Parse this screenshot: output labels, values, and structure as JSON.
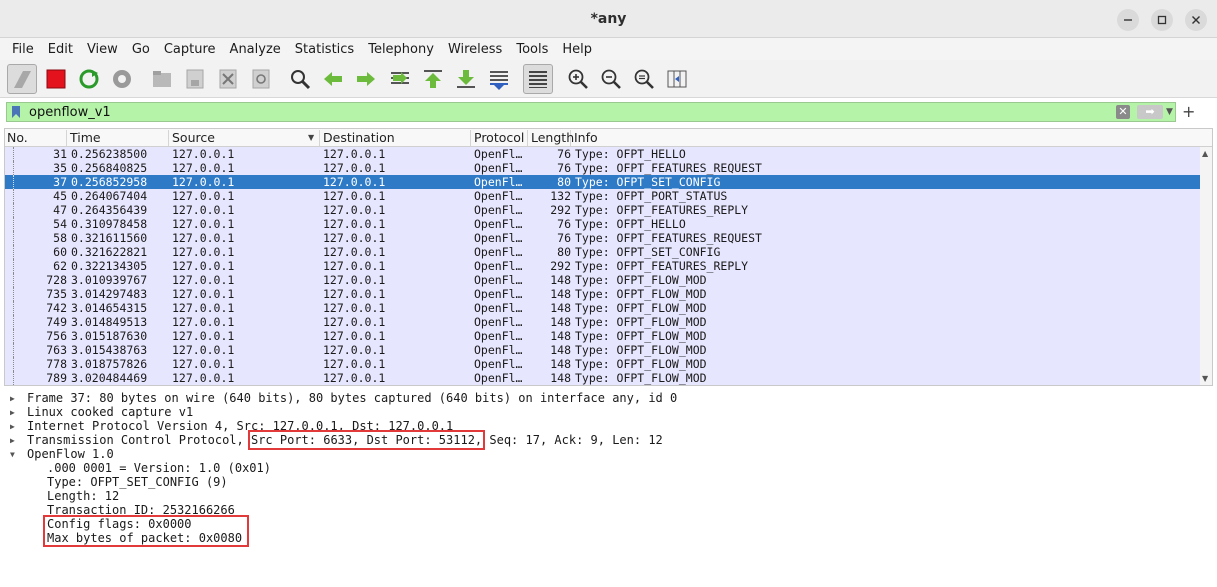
{
  "window": {
    "title": "*any",
    "min_icon": "minimize-icon",
    "max_icon": "maximize-icon",
    "close_icon": "close-icon"
  },
  "menu": [
    "File",
    "Edit",
    "View",
    "Go",
    "Capture",
    "Analyze",
    "Statistics",
    "Telephony",
    "Wireless",
    "Tools",
    "Help"
  ],
  "toolbar": [
    {
      "name": "start-capture-icon"
    },
    {
      "name": "stop-capture-icon"
    },
    {
      "name": "restart-capture-icon"
    },
    {
      "name": "capture-options-icon"
    },
    {
      "name": "open-file-icon"
    },
    {
      "name": "save-file-icon"
    },
    {
      "name": "close-file-icon"
    },
    {
      "name": "reload-file-icon"
    },
    {
      "name": "find-packet-icon"
    },
    {
      "name": "go-back-icon"
    },
    {
      "name": "go-forward-icon"
    },
    {
      "name": "go-to-packet-icon"
    },
    {
      "name": "first-packet-icon"
    },
    {
      "name": "last-packet-icon"
    },
    {
      "name": "autoscroll-icon"
    },
    {
      "name": "colorize-icon"
    },
    {
      "name": "zoom-in-icon"
    },
    {
      "name": "zoom-out-icon"
    },
    {
      "name": "normal-size-icon"
    },
    {
      "name": "resize-columns-icon"
    }
  ],
  "filter": {
    "value": "openflow_v1",
    "bookmark_icon": "bookmark-icon",
    "clear_icon": "clear-filter-icon",
    "apply_icon": "apply-filter-icon",
    "dropdown_icon": "filter-dropdown-icon",
    "add_icon": "add-filter-button-icon"
  },
  "packet_list": {
    "columns": [
      "No.",
      "Time",
      "Source",
      "Destination",
      "Protocol",
      "Length",
      "Info"
    ],
    "rows": [
      {
        "no": "31",
        "time": "0.256238500",
        "src": "127.0.0.1",
        "dst": "127.0.0.1",
        "proto": "OpenFl…",
        "len": "76",
        "info": "Type: OFPT_HELLO"
      },
      {
        "no": "35",
        "time": "0.256840825",
        "src": "127.0.0.1",
        "dst": "127.0.0.1",
        "proto": "OpenFl…",
        "len": "76",
        "info": "Type: OFPT_FEATURES_REQUEST"
      },
      {
        "no": "37",
        "time": "0.256852958",
        "src": "127.0.0.1",
        "dst": "127.0.0.1",
        "proto": "OpenFl…",
        "len": "80",
        "info": "Type: OFPT_SET_CONFIG",
        "selected": true
      },
      {
        "no": "45",
        "time": "0.264067404",
        "src": "127.0.0.1",
        "dst": "127.0.0.1",
        "proto": "OpenFl…",
        "len": "132",
        "info": "Type: OFPT_PORT_STATUS"
      },
      {
        "no": "47",
        "time": "0.264356439",
        "src": "127.0.0.1",
        "dst": "127.0.0.1",
        "proto": "OpenFl…",
        "len": "292",
        "info": "Type: OFPT_FEATURES_REPLY"
      },
      {
        "no": "54",
        "time": "0.310978458",
        "src": "127.0.0.1",
        "dst": "127.0.0.1",
        "proto": "OpenFl…",
        "len": "76",
        "info": "Type: OFPT_HELLO"
      },
      {
        "no": "58",
        "time": "0.321611560",
        "src": "127.0.0.1",
        "dst": "127.0.0.1",
        "proto": "OpenFl…",
        "len": "76",
        "info": "Type: OFPT_FEATURES_REQUEST"
      },
      {
        "no": "60",
        "time": "0.321622821",
        "src": "127.0.0.1",
        "dst": "127.0.0.1",
        "proto": "OpenFl…",
        "len": "80",
        "info": "Type: OFPT_SET_CONFIG"
      },
      {
        "no": "62",
        "time": "0.322134305",
        "src": "127.0.0.1",
        "dst": "127.0.0.1",
        "proto": "OpenFl…",
        "len": "292",
        "info": "Type: OFPT_FEATURES_REPLY"
      },
      {
        "no": "728",
        "time": "3.010939767",
        "src": "127.0.0.1",
        "dst": "127.0.0.1",
        "proto": "OpenFl…",
        "len": "148",
        "info": "Type: OFPT_FLOW_MOD"
      },
      {
        "no": "735",
        "time": "3.014297483",
        "src": "127.0.0.1",
        "dst": "127.0.0.1",
        "proto": "OpenFl…",
        "len": "148",
        "info": "Type: OFPT_FLOW_MOD"
      },
      {
        "no": "742",
        "time": "3.014654315",
        "src": "127.0.0.1",
        "dst": "127.0.0.1",
        "proto": "OpenFl…",
        "len": "148",
        "info": "Type: OFPT_FLOW_MOD"
      },
      {
        "no": "749",
        "time": "3.014849513",
        "src": "127.0.0.1",
        "dst": "127.0.0.1",
        "proto": "OpenFl…",
        "len": "148",
        "info": "Type: OFPT_FLOW_MOD"
      },
      {
        "no": "756",
        "time": "3.015187630",
        "src": "127.0.0.1",
        "dst": "127.0.0.1",
        "proto": "OpenFl…",
        "len": "148",
        "info": "Type: OFPT_FLOW_MOD"
      },
      {
        "no": "763",
        "time": "3.015438763",
        "src": "127.0.0.1",
        "dst": "127.0.0.1",
        "proto": "OpenFl…",
        "len": "148",
        "info": "Type: OFPT_FLOW_MOD"
      },
      {
        "no": "778",
        "time": "3.018757826",
        "src": "127.0.0.1",
        "dst": "127.0.0.1",
        "proto": "OpenFl…",
        "len": "148",
        "info": "Type: OFPT_FLOW_MOD"
      },
      {
        "no": "789",
        "time": "3.020484469",
        "src": "127.0.0.1",
        "dst": "127.0.0.1",
        "proto": "OpenFl…",
        "len": "148",
        "info": "Type: OFPT_FLOW_MOD"
      }
    ]
  },
  "details": {
    "frame": "Frame 37: 80 bytes on wire (640 bits), 80 bytes captured (640 bits) on interface any, id 0",
    "linux": "Linux cooked capture v1",
    "ipv4": "Internet Protocol Version 4, Src: 127.0.0.1, Dst: 127.0.0.1",
    "tcp_prefix": "Transmission Control Protocol, ",
    "tcp_ports": "Src Port: 6633, Dst Port: 53112,",
    "tcp_suffix": " Seq: 17, Ack: 9, Len: 12",
    "openflow": "OpenFlow 1.0",
    "version": ".000 0001 = Version: 1.0 (0x01)",
    "type": "Type: OFPT_SET_CONFIG (9)",
    "length": "Length: 12",
    "xid": "Transaction ID: 2532166266",
    "flags": "Config flags: 0x0000",
    "max_bytes": "Max bytes of packet: 0x0080"
  },
  "colors": {
    "selected_row": "#2f7ac7",
    "row_bg": "#e7e6ff",
    "filter_bg": "#b5f4a8",
    "highlight": "#e23a3a"
  }
}
